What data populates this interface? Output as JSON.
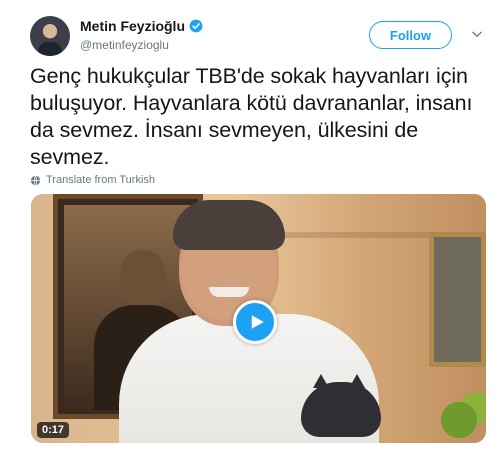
{
  "user": {
    "display_name": "Metin Feyzioğlu",
    "handle": "@metinfeyzioglu",
    "verified_icon": "verified-badge-icon",
    "verified_color": "#1da1f2"
  },
  "follow_label": "Follow",
  "tweet": {
    "text": "Genç hukukçular TBB'de sokak hayvanları için buluşuyor. Hayvanlara kötü davrananlar, insanı da sevmez. İnsanı sevmeyen, ülkesini de sevmez."
  },
  "translate_label": "Translate from Turkish",
  "video": {
    "duration": "0:17",
    "play_icon": "play-icon"
  },
  "colors": {
    "accent": "#1da1f2",
    "text": "#14171a",
    "secondary_text": "#657786"
  }
}
